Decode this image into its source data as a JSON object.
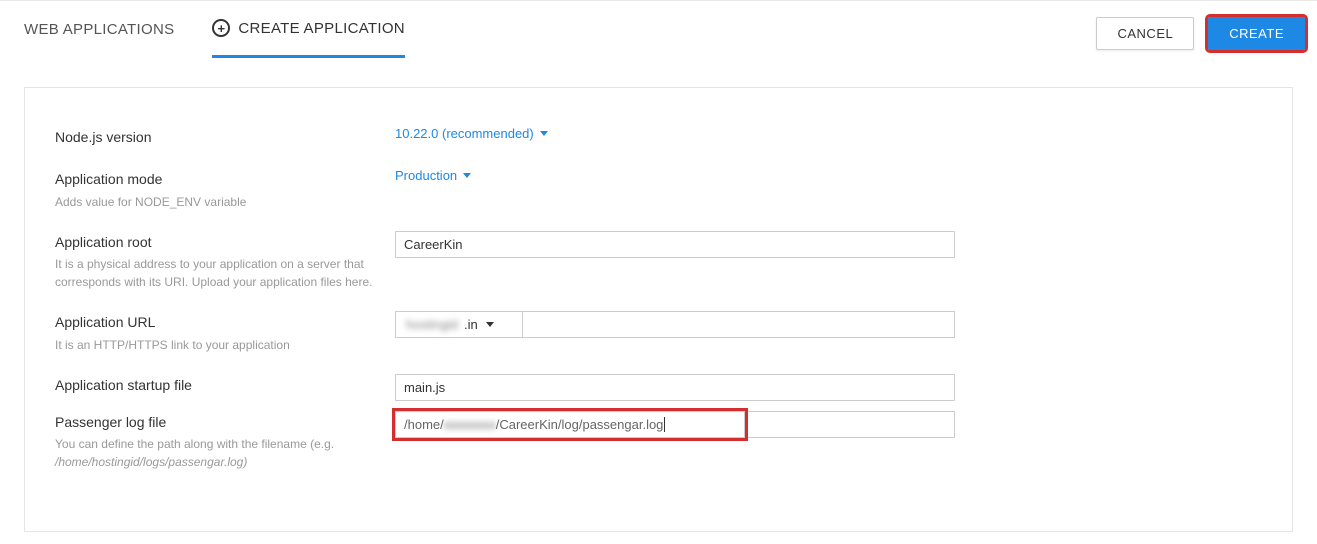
{
  "tabs": {
    "web_apps": "WEB APPLICATIONS",
    "create_app": "CREATE APPLICATION"
  },
  "buttons": {
    "cancel": "CANCEL",
    "create": "CREATE"
  },
  "form": {
    "node_version": {
      "label": "Node.js version",
      "value": "10.22.0 (recommended)"
    },
    "app_mode": {
      "label": "Application mode",
      "desc": "Adds value for NODE_ENV variable",
      "value": "Production"
    },
    "app_root": {
      "label": "Application root",
      "desc": "It is a physical address to your application on a server that corresponds with its URI. Upload your application files here.",
      "value": "CareerKin"
    },
    "app_url": {
      "label": "Application URL",
      "desc": "It is an HTTP/HTTPS link to your application",
      "prefix_masked": "hostingid",
      "prefix_suffix": ".in",
      "value": ""
    },
    "startup_file": {
      "label": "Application startup file",
      "value": "main.js"
    },
    "log_file": {
      "label": "Passenger log file",
      "desc_pre": "You can define the path along with the filename (e.g.",
      "desc_example": "/home/hostingid/logs/passengar.log",
      "desc_post": ")",
      "value_pre": "/home/",
      "value_masked": "xxxxxxxx",
      "value_post": "/CareerKin/log/passengar.log"
    }
  }
}
